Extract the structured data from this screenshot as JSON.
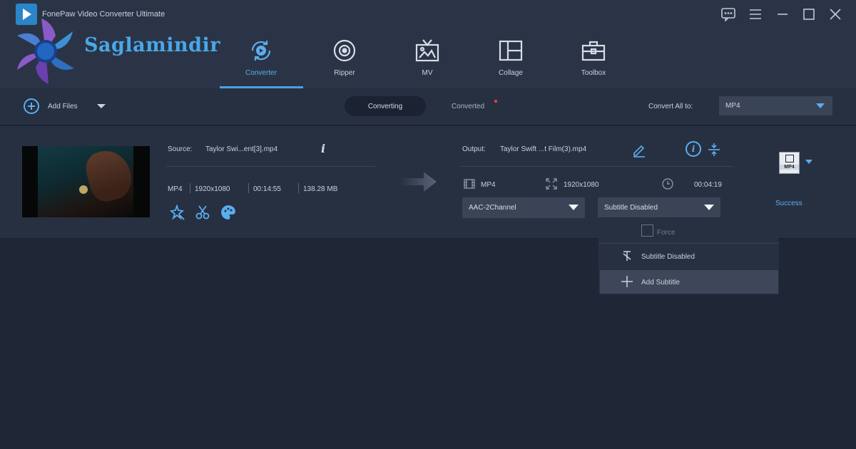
{
  "app": {
    "title": "FonePaw Video Converter Ultimate",
    "watermark_text": "Saglamindir"
  },
  "window_controls": [
    "feedback-icon",
    "menu-icon",
    "minimize-icon",
    "maximize-icon",
    "close-icon"
  ],
  "tabs": [
    {
      "label": "Converter",
      "icon": "converter-icon",
      "active": true
    },
    {
      "label": "Ripper",
      "icon": "disc-icon",
      "active": false
    },
    {
      "label": "MV",
      "icon": "tv-icon",
      "active": false
    },
    {
      "label": "Collage",
      "icon": "collage-icon",
      "active": false
    },
    {
      "label": "Toolbox",
      "icon": "toolbox-icon",
      "active": false
    }
  ],
  "toolbar": {
    "add_files": "Add Files",
    "converting": "Converting",
    "converted": "Converted",
    "convert_all_label": "Convert All to:",
    "convert_all_value": "MP4"
  },
  "file": {
    "source_label": "Source:",
    "source_name": "Taylor Swi...ent[3].mp4",
    "format": "MP4",
    "resolution": "1920x1080",
    "duration": "00:14:55",
    "size": "138.28 MB",
    "output_label": "Output:",
    "output_name": "Taylor Swift ...t Film(3).mp4",
    "out_format": "MP4",
    "out_resolution": "1920x1080",
    "out_duration": "00:04:19",
    "audio_track": "AAC-2Channel",
    "subtitle": "Subtitle Disabled",
    "format_badge": "MP4",
    "status": "Success"
  },
  "subtitle_menu": {
    "force_label": "Force",
    "items": [
      "Subtitle Disabled",
      "Add Subtitle"
    ]
  },
  "colors": {
    "accent": "#5aaef0",
    "background": "#1f2636",
    "panel": "#273041"
  }
}
